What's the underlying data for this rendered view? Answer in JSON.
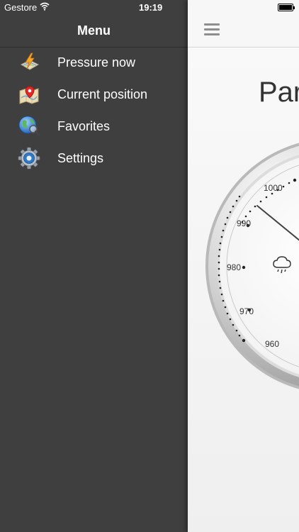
{
  "status_bar": {
    "carrier": "Gestore",
    "time": "19:19"
  },
  "menu": {
    "title": "Menu",
    "items": [
      {
        "label": "Pressure now",
        "icon": "pressure-map-icon"
      },
      {
        "label": "Current position",
        "icon": "map-pin-icon"
      },
      {
        "label": "Favorites",
        "icon": "globe-search-icon"
      },
      {
        "label": "Settings",
        "icon": "gear-icon"
      }
    ]
  },
  "main": {
    "title": "Par",
    "gauge": {
      "tick_labels": [
        "1000",
        "990",
        "980",
        "970",
        "960"
      ],
      "weather_icon": "rain-cloud-icon"
    }
  },
  "colors": {
    "menu_background": "#3f3f3f",
    "content_background": "#f2f2f2"
  }
}
